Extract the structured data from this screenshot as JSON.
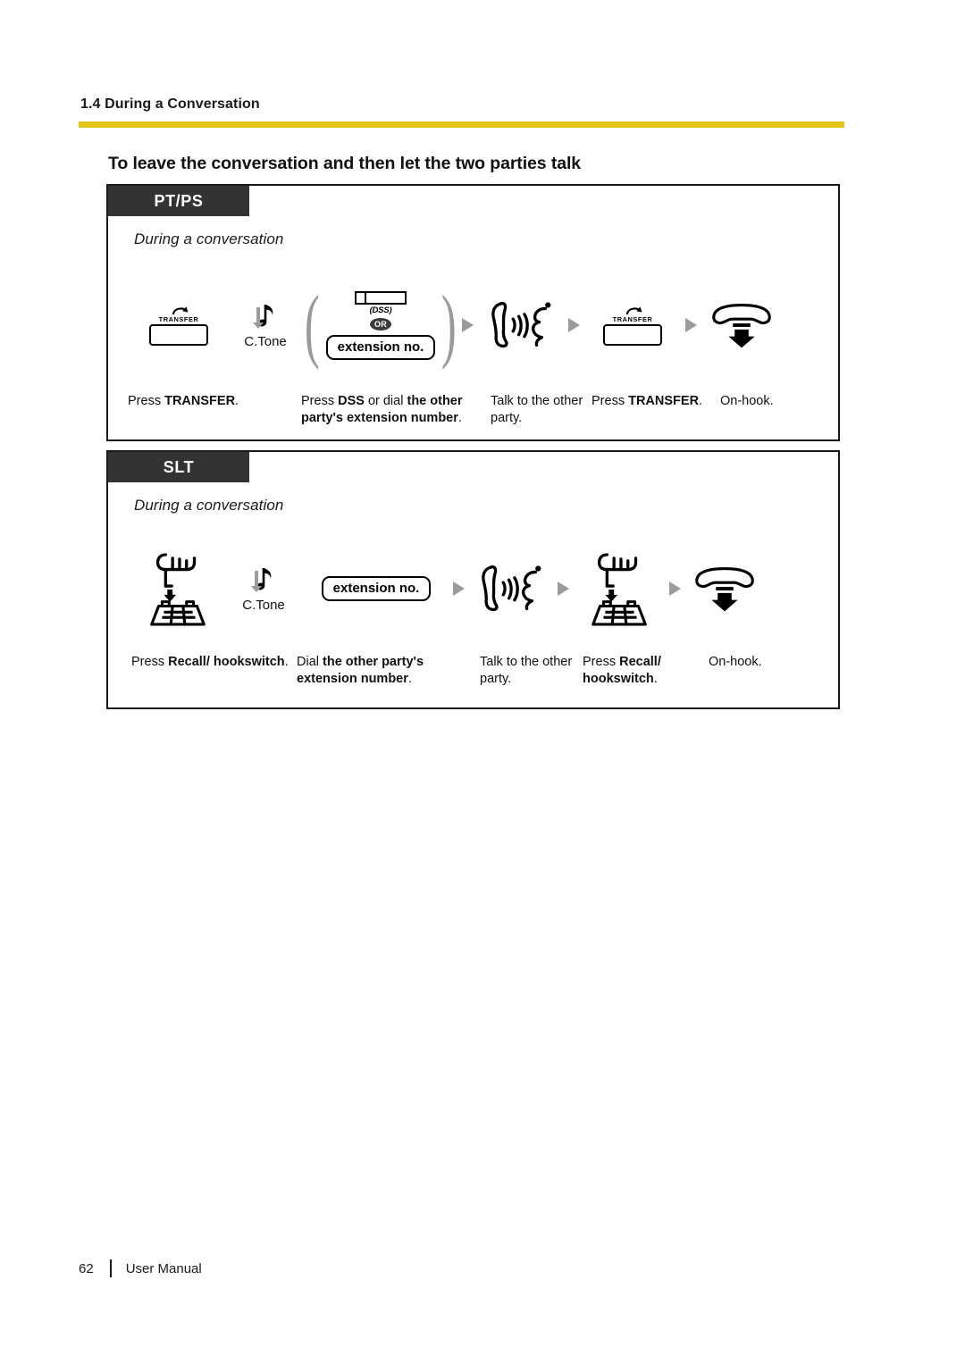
{
  "header": {
    "section_label": "1.4 During a Conversation",
    "rule_color": "#E3C518"
  },
  "main_title": "To leave the conversation and then let the two parties talk",
  "panels": [
    {
      "tab_label": "PT/PS",
      "subtitle": "During a conversation",
      "steps": [
        {
          "icon": "transfer-key-icon",
          "label": "TRANSFER"
        },
        {
          "icon": "confirmation-tone-icon",
          "label": "C.Tone"
        },
        {
          "icon": "dss-or-extension-icon",
          "dss_label": "(DSS)",
          "or_label": "OR",
          "ext_label": "extension no."
        },
        {
          "icon": "talk-to-party-icon"
        },
        {
          "icon": "transfer-key-icon",
          "label": "TRANSFER"
        },
        {
          "icon": "on-hook-icon"
        }
      ],
      "captions": [
        {
          "parts": [
            {
              "t": "Press ",
              "b": false
            },
            {
              "t": "TRANSFER",
              "b": true
            },
            {
              "t": ".",
              "b": false
            }
          ]
        },
        {
          "parts": [
            {
              "t": "Press ",
              "b": false
            },
            {
              "t": "DSS",
              "b": true
            },
            {
              "t": " or dial ",
              "b": false
            },
            {
              "t": "the other party's extension number",
              "b": true
            },
            {
              "t": ".",
              "b": false
            }
          ]
        },
        {
          "parts": [
            {
              "t": "Talk to the other party.",
              "b": false
            }
          ]
        },
        {
          "parts": [
            {
              "t": "Press ",
              "b": false
            },
            {
              "t": "TRANSFER",
              "b": true
            },
            {
              "t": ".",
              "b": false
            }
          ]
        },
        {
          "parts": [
            {
              "t": "On-hook.",
              "b": false
            }
          ]
        }
      ]
    },
    {
      "tab_label": "SLT",
      "subtitle": "During a conversation",
      "steps": [
        {
          "icon": "hookswitch-icon"
        },
        {
          "icon": "confirmation-tone-icon",
          "label": "C.Tone"
        },
        {
          "icon": "extension-number-icon",
          "ext_label": "extension no."
        },
        {
          "icon": "talk-to-party-icon"
        },
        {
          "icon": "hookswitch-icon"
        },
        {
          "icon": "on-hook-icon"
        }
      ],
      "captions": [
        {
          "parts": [
            {
              "t": "Press ",
              "b": false
            },
            {
              "t": "Recall/ hookswitch",
              "b": true
            },
            {
              "t": ".",
              "b": false
            }
          ]
        },
        {
          "parts": [
            {
              "t": "Dial ",
              "b": false
            },
            {
              "t": "the other party's extension number",
              "b": true
            },
            {
              "t": ".",
              "b": false
            }
          ]
        },
        {
          "parts": [
            {
              "t": "Talk to the other party.",
              "b": false
            }
          ]
        },
        {
          "parts": [
            {
              "t": "Press ",
              "b": false
            },
            {
              "t": "Recall/ hookswitch",
              "b": true
            },
            {
              "t": ".",
              "b": false
            }
          ]
        },
        {
          "parts": [
            {
              "t": "On-hook.",
              "b": false
            }
          ]
        }
      ]
    }
  ],
  "footer": {
    "page_number": "62",
    "document_name": "User Manual"
  }
}
